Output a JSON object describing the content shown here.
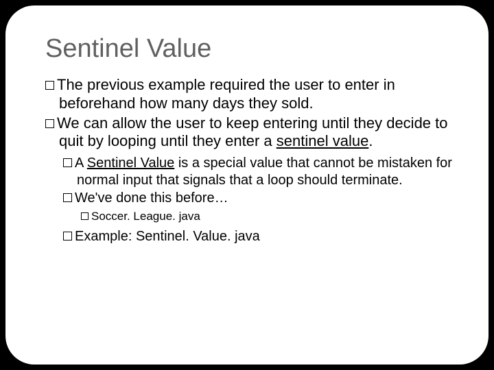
{
  "title": "Sentinel Value",
  "b1a": "The previous example required the user to enter in beforehand how many days they sold.",
  "b2a": "We can allow the user to keep entering until they decide to quit by looping until they enter a ",
  "b2u": "sentinel value",
  "b2b": ".",
  "s1a": "A ",
  "s1u": "Sentinel Value",
  "s1b": " is a special value that cannot be mistaken for normal input that signals that a loop should terminate.",
  "s2": "We've done this before…",
  "t1": "Soccer. League. java",
  "s3a": "Example:  ",
  "s3b": "Sentinel. Value. java"
}
